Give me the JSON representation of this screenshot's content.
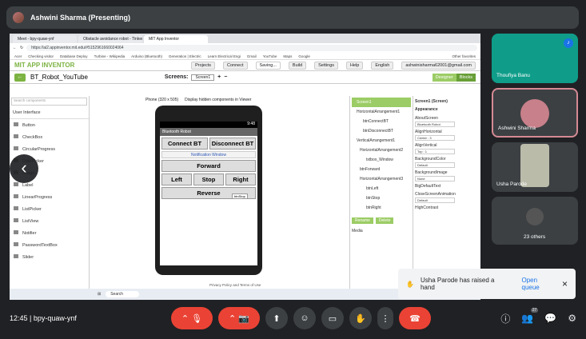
{
  "meeting": {
    "presenter": "Ashwini Sharma (Presenting)",
    "time": "12:45",
    "code": "bpy-quaw-ynf"
  },
  "browser": {
    "tabs": [
      "Meet - bpy-quaw-ynf",
      "Obstacle avoidance robot - Tinker",
      "MIT App Inventor"
    ],
    "url": "https://ai2.appinventor.mit.edu/#5152961660024064",
    "bookmarks": [
      "Acer",
      "Checking visitor",
      "Database Deploy",
      "Turbine - Wikipedia",
      "Arduino (Bluetooth)",
      "Generation | Electric",
      "Learn Electrical Engi",
      "Gmail",
      "YouTube",
      "Maps",
      "Google",
      "Other favorites"
    ]
  },
  "appinventor": {
    "logo": "MIT APP INVENTOR",
    "menu": [
      "Projects",
      "Connect",
      "Build",
      "Settings",
      "Help",
      "English",
      "ashwinisharma62001@gmail.com"
    ],
    "saving": "Saving...",
    "project": "BT_Robot_YouTube",
    "screens_label": "Screens:",
    "screen_sel": "Screen1",
    "designer": "Designer",
    "blocks": "Blocks",
    "palette_search": "Search components",
    "palette_cat": "User Interface",
    "palette_items": [
      "Button",
      "CheckBox",
      "CircularProgress",
      "DatePicker",
      "Image",
      "Label",
      "LinearProgress",
      "ListPicker",
      "ListView",
      "Notifier",
      "PasswordTextBox",
      "Slider"
    ],
    "viewer_device": "Phone (320 x 505)",
    "viewer_hidden": "Display hidden components in Viewer",
    "phone": {
      "time": "9:48",
      "title": "Bluetooth Robot",
      "connect": "Connect BT",
      "disconnect": "Disconnect BT",
      "notif": "Notification Window",
      "forward": "Forward",
      "left": "Left",
      "stop": "Stop",
      "right": "Right",
      "reverse": "Reverse",
      "tooltip": "btnStop"
    },
    "tree": [
      "Screen1",
      "HorizontalArrangement1",
      "btnConnectBT",
      "btnDisconnectBT",
      "VerticalArrangement1",
      "HorizontalArrangement2",
      "txtbox_Window",
      "btnForward",
      "HorizontalArrangement3",
      "btnLeft",
      "btnStop",
      "btnRight"
    ],
    "tree_buttons": [
      "Rename",
      "Delete"
    ],
    "media": "Media",
    "props_title": "Screen1 (Screen)",
    "props_section": "Appearance",
    "props": [
      {
        "k": "AboutScreen",
        "v": "Bluetooth Robot"
      },
      {
        "k": "AlignHorizontal",
        "v": "Center : 3"
      },
      {
        "k": "AlignVertical",
        "v": "Top : 1"
      },
      {
        "k": "BackgroundColor",
        "v": "Default"
      },
      {
        "k": "BackgroundImage",
        "v": "None"
      },
      {
        "k": "BigDefaultText",
        "v": ""
      },
      {
        "k": "CloseScreenAnimation",
        "v": "Default"
      },
      {
        "k": "HighContrast",
        "v": ""
      }
    ],
    "footer": "Privacy Policy and Terms of Use"
  },
  "taskbar": {
    "search": "Search"
  },
  "participants": [
    {
      "name": "Thoufiya Banu",
      "color": "#0f9d8a"
    },
    {
      "name": "Ashwini Sharma",
      "color": "#c8808a"
    },
    {
      "name": "Usha Parode",
      "color": "#bba"
    },
    {
      "name": "23 others",
      "color": "#555"
    }
  ],
  "toast": {
    "text": "Usha Parode has raised a hand",
    "link": "Open queue"
  },
  "people_count": "27"
}
